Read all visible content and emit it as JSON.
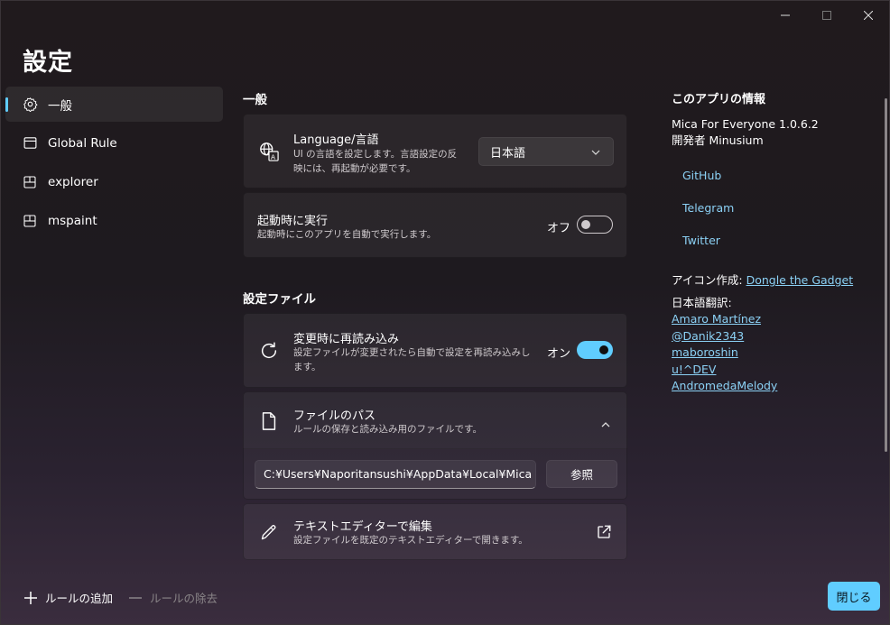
{
  "window": {
    "title": "設定"
  },
  "sidebar": {
    "items": [
      {
        "label": "一般",
        "icon": "gear-icon",
        "selected": true
      },
      {
        "label": "Global Rule",
        "icon": "window-icon"
      },
      {
        "label": "explorer",
        "icon": "app-icon"
      },
      {
        "label": "mspaint",
        "icon": "app-icon"
      }
    ],
    "add_rule": "ルールの追加",
    "remove_rule": "ルールの除去"
  },
  "general": {
    "section_title": "一般",
    "language": {
      "title": "Language/言語",
      "desc_line1": "UI の言語を設定します。言語設定の反",
      "desc_line2": "映には、再起動が必要です。",
      "selected": "日本語"
    },
    "startup": {
      "title": "起動時に実行",
      "desc": "起動時にこのアプリを自動で実行します。",
      "state_label": "オフ",
      "enabled": false
    }
  },
  "config": {
    "section_title": "設定ファイル",
    "reload": {
      "title": "変更時に再読み込み",
      "desc_line1": "設定ファイルが変更されたら自動で設定を再読み込みし",
      "desc_line2": "ます。",
      "state_label": "オン",
      "enabled": true
    },
    "file_path": {
      "title": "ファイルのパス",
      "desc": "ルールの保存と読み込み用のファイルです。",
      "value": "C:¥Users¥Naporitansushi¥AppData¥Local¥Mica",
      "browse_label": "参照"
    },
    "edit": {
      "title": "テキストエディターで編集",
      "desc": "設定ファイルを既定のテキストエディターで開きます。"
    }
  },
  "about": {
    "heading": "このアプリの情報",
    "version": "Mica For Everyone 1.0.6.2",
    "developer": "開発者 Minusium",
    "links": [
      "GitHub",
      "Telegram",
      "Twitter"
    ],
    "icon_credit_label": "アイコン作成:",
    "icon_credit_name": "Dongle the Gadget",
    "translators_label": "日本語翻訳:",
    "translators": [
      "Amaro Martínez",
      "@Danik2343",
      "maboroshin",
      "u!^DEV",
      "AndromedaMelody"
    ]
  },
  "footer": {
    "close_label": "閉じる"
  },
  "colors": {
    "accent": "#60cdff",
    "link": "#8bd1f5"
  }
}
